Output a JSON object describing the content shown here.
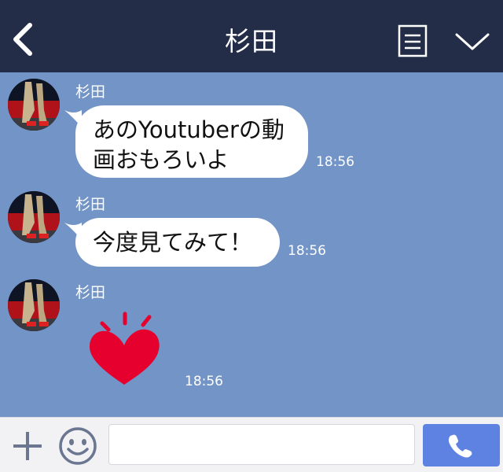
{
  "header": {
    "title": "杉田",
    "back_icon": "chevron-left-icon",
    "notes_icon": "notes-icon",
    "menu_icon": "chevron-down-icon"
  },
  "messages": [
    {
      "sender": "杉田",
      "text_line1": "あのYoutuberの動",
      "text_line2": "画おもろいよ",
      "time": "18:56",
      "type": "text"
    },
    {
      "sender": "杉田",
      "text_line1": "今度見てみて！",
      "time": "18:56",
      "type": "text"
    },
    {
      "sender": "杉田",
      "sticker": "heart-sticker-icon",
      "time": "18:56",
      "type": "sticker"
    }
  ],
  "input": {
    "value": "",
    "placeholder": "",
    "plus_icon": "plus-icon",
    "emoji_icon": "emoji-icon",
    "call_icon": "phone-icon"
  },
  "colors": {
    "header_bg": "#232d47",
    "chat_bg": "#7394c6",
    "call_button": "#5d82e2",
    "heart": "#e5002d"
  }
}
